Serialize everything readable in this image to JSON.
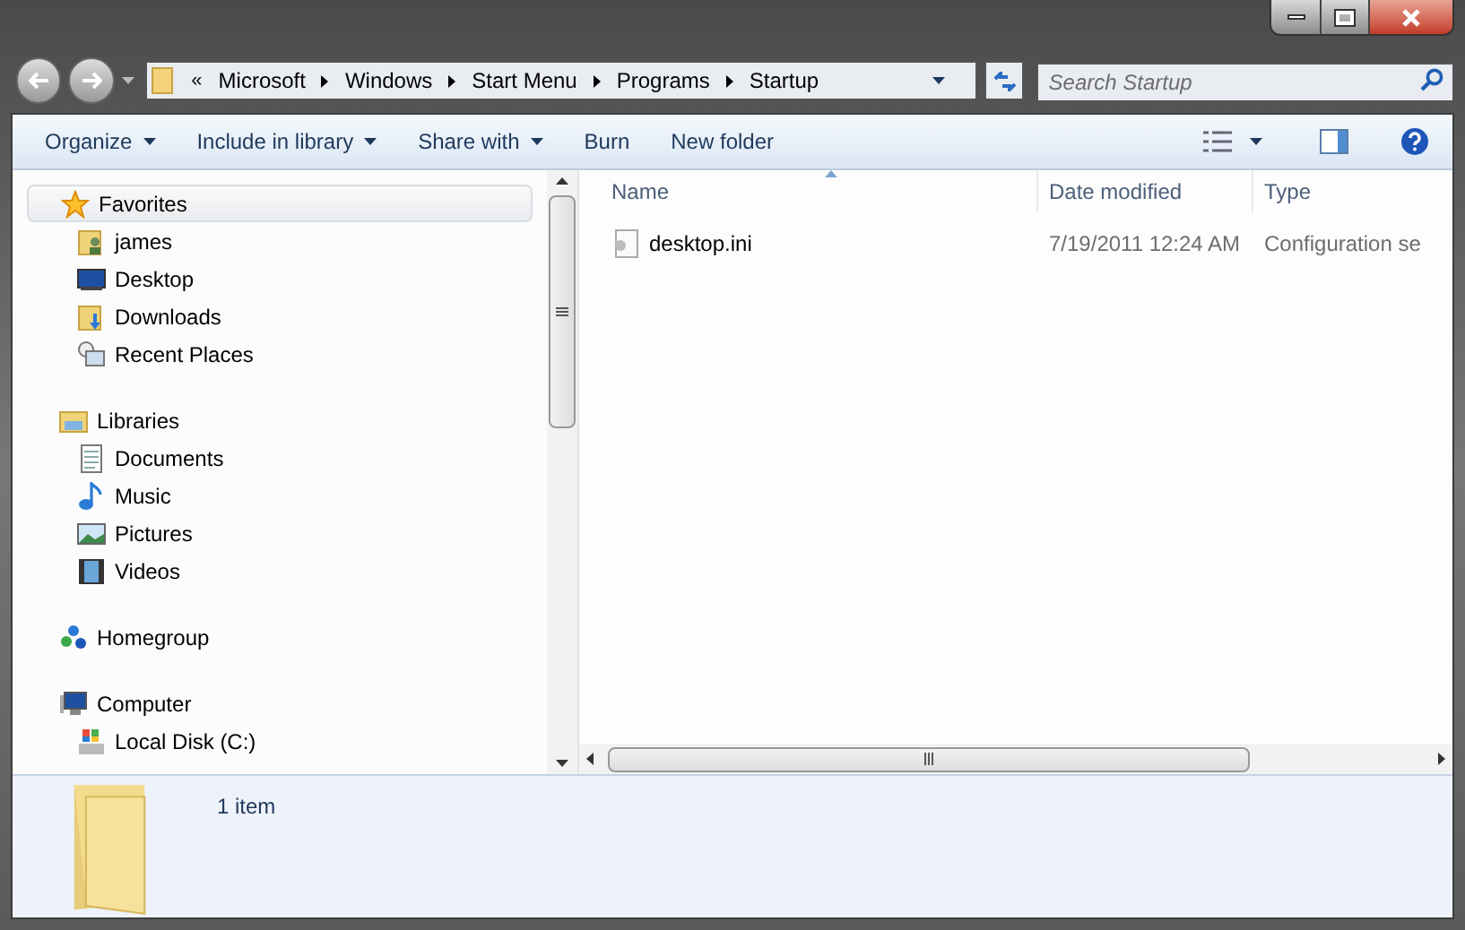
{
  "address": {
    "overflow": "«",
    "segments": [
      "Microsoft",
      "Windows",
      "Start Menu",
      "Programs",
      "Startup"
    ]
  },
  "search": {
    "placeholder": "Search Startup"
  },
  "toolbar": [
    {
      "label": "Organize",
      "dropdown": true
    },
    {
      "label": "Include in library",
      "dropdown": true
    },
    {
      "label": "Share with",
      "dropdown": true
    },
    {
      "label": "Burn",
      "dropdown": false
    },
    {
      "label": "New folder",
      "dropdown": false
    }
  ],
  "nav": [
    {
      "label": "Favorites",
      "kind": "star",
      "highlighted": true,
      "children": [
        {
          "label": "james",
          "kind": "user"
        },
        {
          "label": "Desktop",
          "kind": "desktop"
        },
        {
          "label": "Downloads",
          "kind": "download"
        },
        {
          "label": "Recent Places",
          "kind": "recent"
        }
      ]
    },
    {
      "label": "Libraries",
      "kind": "library",
      "highlighted": false,
      "children": [
        {
          "label": "Documents",
          "kind": "document"
        },
        {
          "label": "Music",
          "kind": "music"
        },
        {
          "label": "Pictures",
          "kind": "pictures"
        },
        {
          "label": "Videos",
          "kind": "video"
        }
      ]
    },
    {
      "label": "Homegroup",
      "kind": "homegroup",
      "highlighted": false
    },
    {
      "label": "Computer",
      "kind": "computer",
      "highlighted": false,
      "children": [
        {
          "label": "Local Disk (C:)",
          "kind": "disk"
        }
      ]
    }
  ],
  "columns": [
    {
      "label": "Name",
      "sorted": true
    },
    {
      "label": "Date modified",
      "sorted": false
    },
    {
      "label": "Type",
      "sorted": false
    }
  ],
  "rows": [
    {
      "name": "desktop.ini",
      "date": "7/19/2011 12:24 AM",
      "type": "Configuration se"
    }
  ],
  "status": "1 item"
}
